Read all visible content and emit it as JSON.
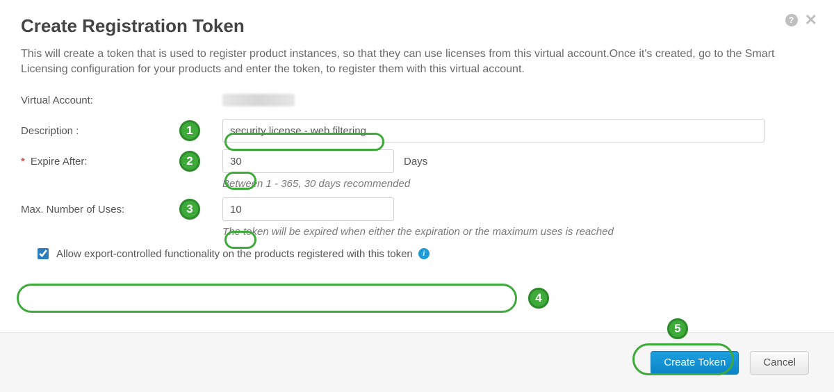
{
  "header": {
    "title": "Create Registration Token"
  },
  "intro": "This will create a token that is used to register product instances, so that they can use licenses from this virtual account.Once it's created, go to the Smart Licensing configuration for your products and enter the token, to register them with this virtual account.",
  "form": {
    "virtual_account_label": "Virtual Account:",
    "description_label": "Description :",
    "description_value": "security license - web filtering",
    "expire_label": "Expire After:",
    "expire_value": "30",
    "days_label": "Days",
    "expire_hint": "Between 1 - 365, 30 days recommended",
    "max_uses_label": "Max. Number of Uses:",
    "max_uses_value": "10",
    "max_uses_hint": "The token will be expired when either the expiration or the maximum uses is reached",
    "export_checkbox_label": "Allow export-controlled functionality on the products registered with this token",
    "export_checked": true
  },
  "footer": {
    "primary": "Create Token",
    "cancel": "Cancel"
  },
  "annotations": {
    "step1": "1",
    "step2": "2",
    "step3": "3",
    "step4": "4",
    "step5": "5"
  }
}
